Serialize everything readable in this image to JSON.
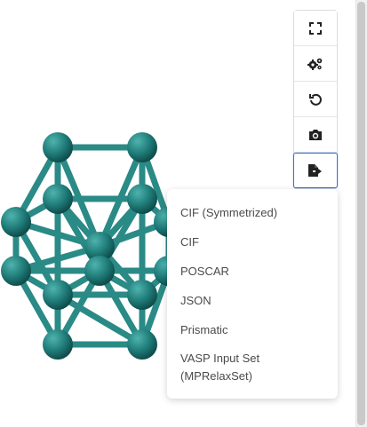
{
  "toolbar": {
    "buttons": [
      {
        "icon": "expand-icon",
        "name": "fullscreen-button"
      },
      {
        "icon": "gears-icon",
        "name": "settings-button"
      },
      {
        "icon": "undo-icon",
        "name": "reset-view-button"
      },
      {
        "icon": "camera-icon",
        "name": "screenshot-button"
      },
      {
        "icon": "file-export-icon",
        "name": "export-button",
        "active": true
      }
    ]
  },
  "export_menu": {
    "items": [
      {
        "label": "CIF (Symmetrized)"
      },
      {
        "label": "CIF"
      },
      {
        "label": "POSCAR"
      },
      {
        "label": "JSON"
      },
      {
        "label": "Prismatic"
      },
      {
        "label_line1": "VASP Input Set",
        "label_line2": "(MPRelaxSet)"
      }
    ]
  },
  "colors": {
    "atom": "#1f7b78",
    "bond": "#2a8a86",
    "active_border": "#3d6fd6",
    "menu_text": "#4a4a4a"
  }
}
